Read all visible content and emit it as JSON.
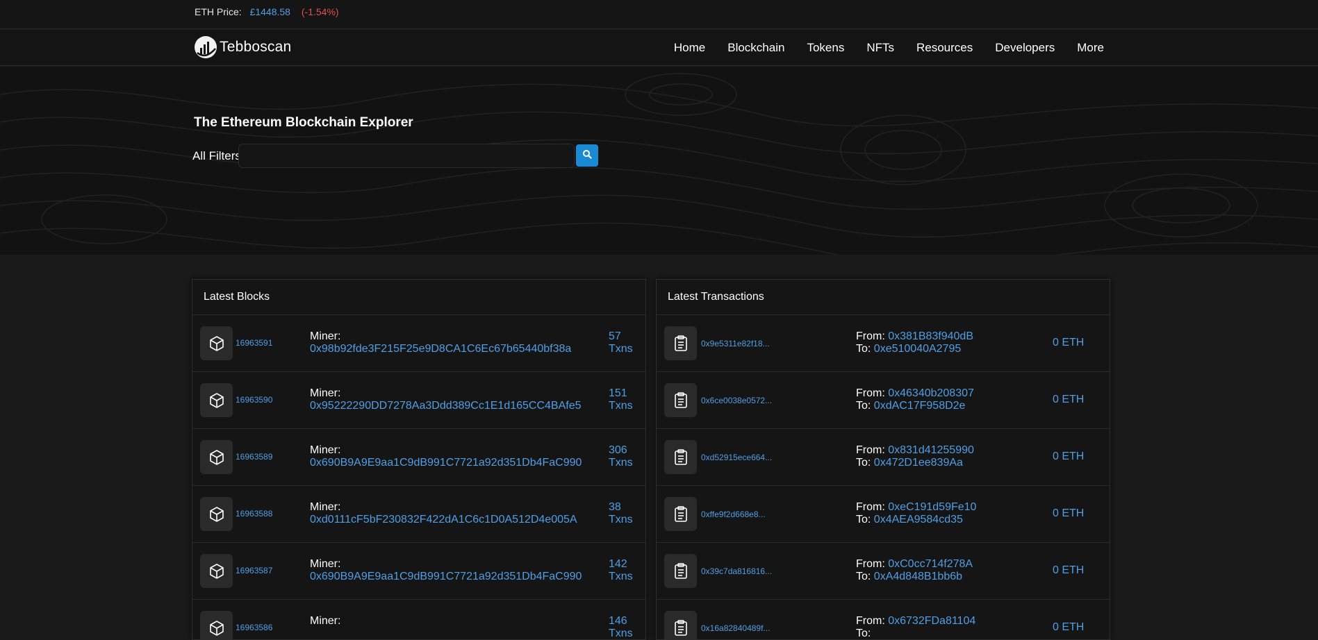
{
  "price_bar": {
    "label": "ETH Price:",
    "value": "£1448.58",
    "change": "(-1.54%)"
  },
  "brand": {
    "name": "Tebboscan"
  },
  "nav": [
    "Home",
    "Blockchain",
    "Tokens",
    "NFTs",
    "Resources",
    "Developers",
    "More"
  ],
  "hero": {
    "title": "The Ethereum Blockchain Explorer",
    "filter_label": "All Filters",
    "search_placeholder": ""
  },
  "latest_blocks": {
    "title": "Latest Blocks",
    "miner_label": "Miner:",
    "txns_label": "Txns",
    "rows": [
      {
        "block": "16963591",
        "miner": "0x98b92fde3F215F25e9D8CA1C6Ec67b65440bf38a",
        "txns": "57"
      },
      {
        "block": "16963590",
        "miner": "0x95222290DD7278Aa3Ddd389Cc1E1d165CC4BAfe5",
        "txns": "151"
      },
      {
        "block": "16963589",
        "miner": "0x690B9A9E9aa1C9dB991C7721a92d351Db4FaC990",
        "txns": "306"
      },
      {
        "block": "16963588",
        "miner": "0xd0111cF5bF230832F422dA1C6c1D0A512D4e005A",
        "txns": "38"
      },
      {
        "block": "16963587",
        "miner": "0x690B9A9E9aa1C9dB991C7721a92d351Db4FaC990",
        "txns": "142"
      },
      {
        "block": "16963586",
        "miner": "",
        "txns": "146"
      }
    ]
  },
  "latest_transactions": {
    "title": "Latest Transactions",
    "from_label": "From:",
    "to_label": "To:",
    "rows": [
      {
        "hash": "0x9e5311e82f18...",
        "from": "0x381B83f940dB",
        "to": "0xe510040A2795",
        "value": "0 ETH"
      },
      {
        "hash": "0x6ce0038e0572...",
        "from": "0x46340b208307",
        "to": "0xdAC17F958D2e",
        "value": "0 ETH"
      },
      {
        "hash": "0xd52915ece664...",
        "from": "0x831d41255990",
        "to": "0x472D1ee839Aa",
        "value": "0 ETH"
      },
      {
        "hash": "0xffe9f2d668e8...",
        "from": "0xeC191d59Fe10",
        "to": "0x4AEA9584cd35",
        "value": "0 ETH"
      },
      {
        "hash": "0x39c7da816816...",
        "from": "0xC0cc714f278A",
        "to": "0xA4d848B1bb6b",
        "value": "0 ETH"
      },
      {
        "hash": "0x16a82840489f...",
        "from": "0x6732FDa81104",
        "to": "",
        "value": "0 ETH"
      }
    ]
  }
}
